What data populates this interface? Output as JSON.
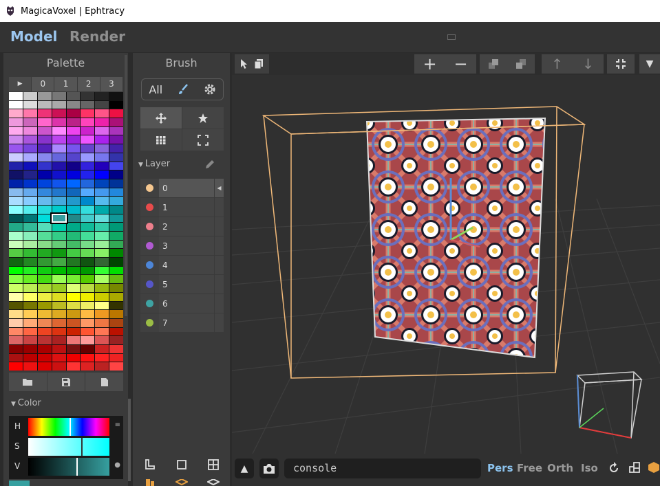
{
  "window": {
    "title": "MagicaVoxel | Ephtracy"
  },
  "modes": {
    "model": "Model",
    "render": "Render"
  },
  "palette": {
    "title": "Palette",
    "header": [
      "▶",
      "0",
      "1",
      "2",
      "3"
    ],
    "colors": [
      "#ffffff",
      "#cccccc",
      "#999999",
      "#777777",
      "#555555",
      "#333333",
      "#222222",
      "#111111",
      "#ffffff",
      "#dddddd",
      "#bbbbbb",
      "#aaaaaa",
      "#888888",
      "#666666",
      "#444444",
      "#000000",
      "#ffaacc",
      "#ff77aa",
      "#ee3377",
      "#cc1155",
      "#aa0044",
      "#ff3366",
      "#ff5588",
      "#ee1144",
      "#ee99dd",
      "#cc66bb",
      "#ff66cc",
      "#dd33aa",
      "#bb2288",
      "#ff44bb",
      "#ee22aa",
      "#aa1177",
      "#ffaaee",
      "#ee88dd",
      "#cc55cc",
      "#ff88ff",
      "#ee44ee",
      "#cc22cc",
      "#dd66ee",
      "#aa33bb",
      "#cc88ee",
      "#aa55dd",
      "#8833cc",
      "#bb44ee",
      "#9922dd",
      "#ee55ff",
      "#aa22ee",
      "#7711aa",
      "#9955ee",
      "#7744dd",
      "#5522bb",
      "#aa88ff",
      "#7755ee",
      "#6644cc",
      "#8866dd",
      "#4422aa",
      "#ccccff",
      "#aaaaff",
      "#8888ee",
      "#6666dd",
      "#5544cc",
      "#9999ff",
      "#7777ee",
      "#3333aa",
      "#2222aa",
      "#1111bb",
      "#3333cc",
      "#2211aa",
      "#110088",
      "#3322dd",
      "#2200bb",
      "#4444ee",
      "#111166",
      "#222288",
      "#0000aa",
      "#1111cc",
      "#0000dd",
      "#2222ee",
      "#0000ff",
      "#000088",
      "#0022aa",
      "#0033cc",
      "#0044dd",
      "#1155ee",
      "#0066ff",
      "#2266dd",
      "#0044bb",
      "#003399",
      "#88bbee",
      "#66aaee",
      "#3388dd",
      "#2277cc",
      "#1166bb",
      "#55aaff",
      "#4499ee",
      "#2288dd",
      "#aaddff",
      "#88ccff",
      "#66bbee",
      "#44aadd",
      "#2299cc",
      "#0088cc",
      "#55bbee",
      "#33aadd",
      "#88ffff",
      "#55eeee",
      "#22dddd",
      "#00cccc",
      "#00bbcc",
      "#33dddd",
      "#00aaaa",
      "#008888",
      "#005555",
      "#007777",
      "#00dddd",
      "#36a0a0",
      "#228888",
      "#44cccc",
      "#66dddd",
      "#119999",
      "#22aa88",
      "#33bb99",
      "#55ddbb",
      "#00ccaa",
      "#00aa88",
      "#11bb99",
      "#33ccaa",
      "#009977",
      "#aaffcc",
      "#88eebb",
      "#55dd99",
      "#33cc88",
      "#22bb77",
      "#44dd99",
      "#66eeaa",
      "#11aa66",
      "#ccffbb",
      "#aaeea0",
      "#88dd88",
      "#66cc77",
      "#44bb66",
      "#77dd88",
      "#99ee99",
      "#33aa55",
      "#55cc44",
      "#33bb33",
      "#22aa22",
      "#119911",
      "#44cc44",
      "#66dd55",
      "#88ee66",
      "#008800",
      "#116611",
      "#228822",
      "#339933",
      "#44aa44",
      "#227722",
      "#115511",
      "#336633",
      "#004400",
      "#00ff00",
      "#22ee22",
      "#11cc11",
      "#00bb00",
      "#00aa00",
      "#009900",
      "#33ff33",
      "#00dd00",
      "#88ff44",
      "#66ee22",
      "#44dd11",
      "#99ff55",
      "#77ee33",
      "#55cc00",
      "#aaff66",
      "#66bb11",
      "#ccff66",
      "#bbee55",
      "#aadd33",
      "#99cc22",
      "#ddff77",
      "#bbdd44",
      "#99bb11",
      "#778800",
      "#ffffaa",
      "#ffff66",
      "#eeee44",
      "#dddd22",
      "#ffff00",
      "#eeee00",
      "#cccc00",
      "#aaaa00",
      "#555500",
      "#777700",
      "#999900",
      "#bbbb22",
      "#dddd44",
      "#eeee66",
      "#ffff88",
      "#333300",
      "#ffdd88",
      "#ffcc55",
      "#eebb33",
      "#ddaa22",
      "#cc9911",
      "#ffbb44",
      "#ee9922",
      "#bb7700",
      "#ffccaa",
      "#ffaa77",
      "#ee8855",
      "#dd6633",
      "#cc5522",
      "#ff9966",
      "#ee7744",
      "#aa4411",
      "#ff8866",
      "#ff6644",
      "#ee4422",
      "#dd3311",
      "#cc2200",
      "#ff5533",
      "#ff7755",
      "#bb1100",
      "#dd6666",
      "#cc4444",
      "#bb3333",
      "#aa2222",
      "#ee7777",
      "#ff9999",
      "#dd5555",
      "#992222",
      "#880000",
      "#990000",
      "#aa0000",
      "#bb1111",
      "#771111",
      "#660000",
      "#cc2222",
      "#ee3333",
      "#aa1111",
      "#bb0000",
      "#cc0000",
      "#dd1111",
      "#ee0000",
      "#ff1111",
      "#ff2222",
      "#ee2222",
      "#ff0000",
      "#ee1111",
      "#dd0000",
      "#cc1111",
      "#ff3333",
      "#dd2222",
      "#bb2222",
      "#ff4444"
    ],
    "selected_index": 115
  },
  "color": {
    "label": "Color",
    "h_label": "H",
    "s_label": "S",
    "v_label": "V",
    "current": "#36a0a0"
  },
  "brush": {
    "title": "Brush",
    "all_label": "All",
    "layer_label": "Layer",
    "layers": [
      {
        "name": "0",
        "color": "#f5c78f"
      },
      {
        "name": "1",
        "color": "#e84b4b"
      },
      {
        "name": "2",
        "color": "#ee7f8c"
      },
      {
        "name": "3",
        "color": "#b15ad2"
      },
      {
        "name": "4",
        "color": "#4d86d8"
      },
      {
        "name": "5",
        "color": "#5656c8"
      },
      {
        "name": "6",
        "color": "#3ea3a3"
      },
      {
        "name": "7",
        "color": "#9bbd45"
      }
    ]
  },
  "viewport": {
    "console_text": "console",
    "view_modes": [
      "Pers",
      "Free",
      "Orth",
      "Iso"
    ],
    "active_view_mode": "Pers"
  },
  "colors": {
    "accent": "#8cc3ee",
    "bounding_box": "#f0b878"
  }
}
